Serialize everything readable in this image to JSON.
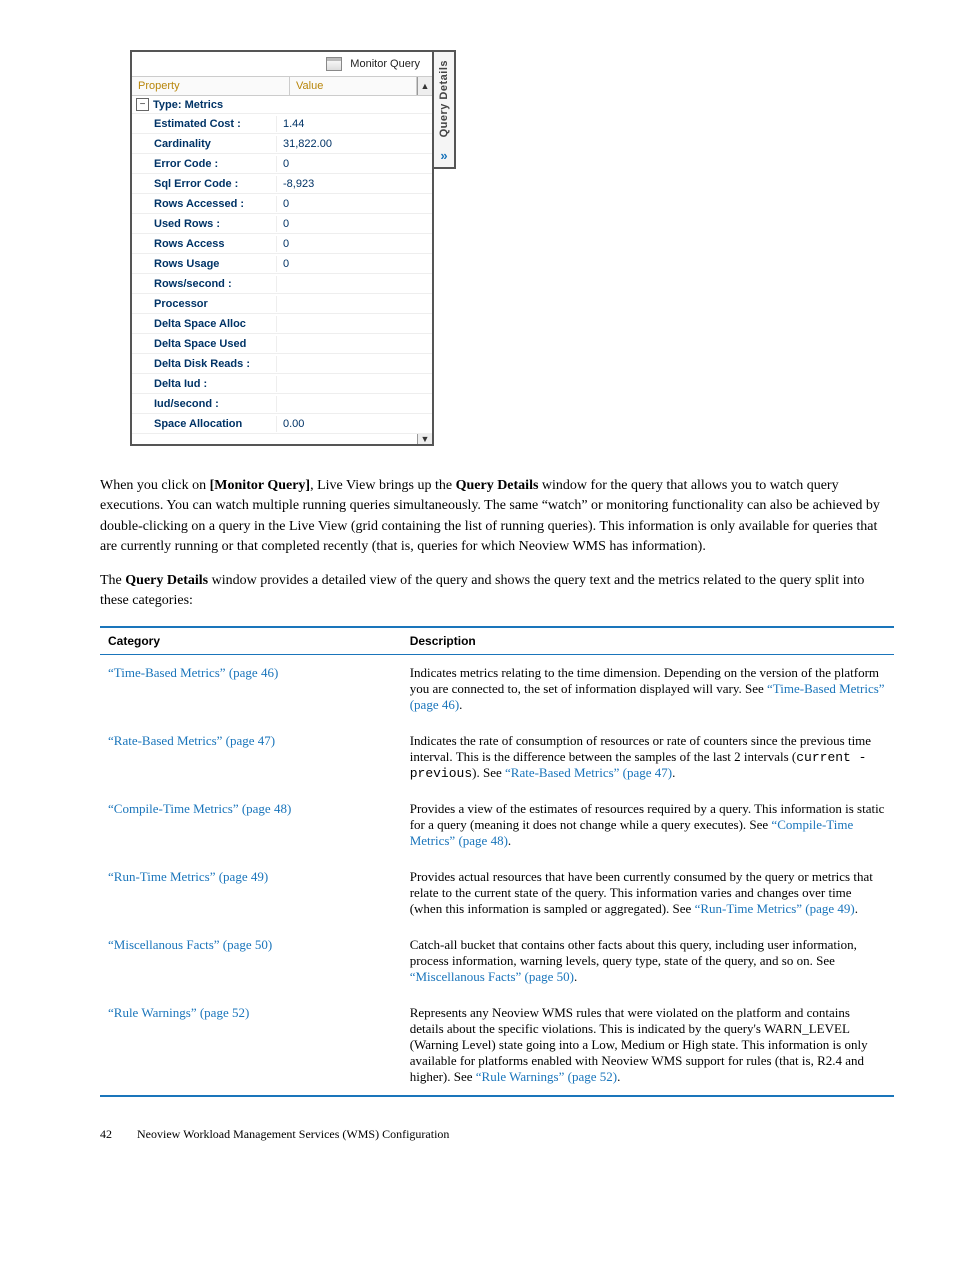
{
  "widget": {
    "title": "Monitor Query",
    "header_property": "Property",
    "header_value": "Value",
    "group_label": "Type: Metrics",
    "side_tab": "Query Details",
    "rows": [
      {
        "prop": "Estimated Cost :",
        "val": "1.44"
      },
      {
        "prop": "Cardinality",
        "val": "31,822.00"
      },
      {
        "prop": "Error Code :",
        "val": "0"
      },
      {
        "prop": "Sql Error Code :",
        "val": "-8,923"
      },
      {
        "prop": "Rows Accessed :",
        "val": "0"
      },
      {
        "prop": "Used Rows :",
        "val": "0"
      },
      {
        "prop": "Rows Access",
        "val": "0"
      },
      {
        "prop": "Rows Usage",
        "val": "0"
      },
      {
        "prop": "Rows/second :",
        "val": ""
      },
      {
        "prop": "Processor",
        "val": ""
      },
      {
        "prop": "Delta Space Alloc",
        "val": ""
      },
      {
        "prop": "Delta Space Used",
        "val": ""
      },
      {
        "prop": "Delta Disk Reads :",
        "val": ""
      },
      {
        "prop": "Delta Iud :",
        "val": ""
      },
      {
        "prop": "Iud/second :",
        "val": ""
      },
      {
        "prop": "Space Allocation",
        "val": "0.00"
      }
    ]
  },
  "para1": {
    "t1": "When you click on ",
    "b1": "[Monitor Query]",
    "t2": ", Live View brings up the ",
    "b2": "Query Details",
    "t3": " window for the query that allows you to watch query executions. You can watch multiple running queries simultaneously. The same “watch” or monitoring functionality can also be achieved by double-clicking on a query in the Live View (grid containing the list of running queries). This information is only available for queries that are currently running or that completed recently (that is, queries for which Neoview WMS has information)."
  },
  "para2": {
    "t1": "The ",
    "b1": "Query Details",
    "t2": " window provides a detailed view of the query and shows the query text and the metrics related to the query split into these categories:"
  },
  "cat_header": {
    "c1": "Category",
    "c2": "Description"
  },
  "cats": [
    {
      "label": "“Time-Based Metrics” (page 46)",
      "desc_pre": "Indicates metrics relating to the time dimension. Depending on the version of the platform you are connected to, the set of information displayed will vary. See ",
      "desc_link": "“Time-Based Metrics” (page 46)",
      "desc_post": "."
    },
    {
      "label": "“Rate-Based Metrics” (page 47)",
      "desc_pre": "Indicates the rate of consumption of resources or rate of counters since the previous time interval. This is the difference between the samples of the last 2 intervals (",
      "mono": "current - previous",
      "desc_mid": "). See ",
      "desc_link": "“Rate-Based Metrics” (page 47)",
      "desc_post": "."
    },
    {
      "label": "“Compile-Time Metrics” (page 48)",
      "desc_pre": "Provides a view of the estimates of resources required by a query. This information is static for a query (meaning it does not change while a query executes). See ",
      "desc_link": "“Compile-Time Metrics” (page 48)",
      "desc_post": "."
    },
    {
      "label": "“Run-Time Metrics” (page 49)",
      "desc_pre": "Provides actual resources that have been currently consumed by the query or metrics that relate to the current state of the query. This information varies and changes over time (when this information is sampled or aggregated). See ",
      "desc_link": "“Run-Time Metrics” (page 49)",
      "desc_post": "."
    },
    {
      "label": "“Miscellanous Facts” (page 50)",
      "desc_pre": "Catch-all bucket that contains other facts about this query, including user information, process information, warning levels, query type, state of the query, and so on. See ",
      "desc_link": "“Miscellanous Facts” (page 50)",
      "desc_post": "."
    },
    {
      "label": "“Rule Warnings” (page 52)",
      "desc_pre": "Represents any Neoview WMS rules that were violated on the platform and contains details about the specific violations. This is indicated by the query's WARN_LEVEL (Warning Level) state going into a Low, Medium or High state. This information is only available for platforms enabled with Neoview WMS support for rules (that is, R2.4 and higher). See ",
      "desc_link": "“Rule Warnings” (page 52)",
      "desc_post": "."
    }
  ],
  "footer": {
    "page": "42",
    "title": "Neoview Workload Management Services (WMS) Configuration"
  }
}
